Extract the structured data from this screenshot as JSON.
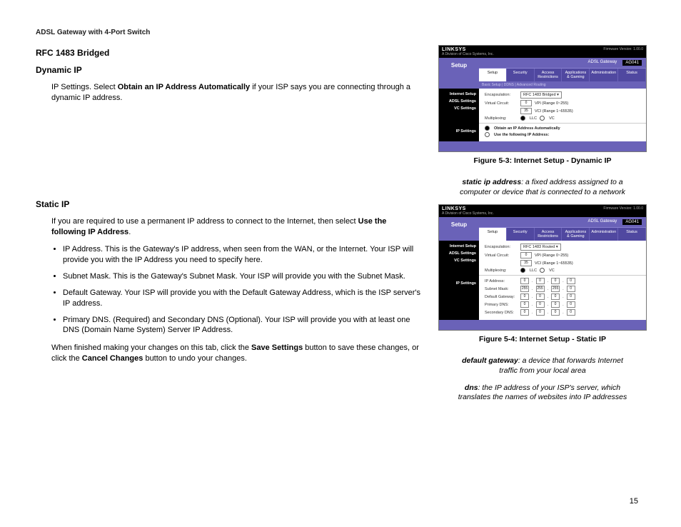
{
  "header": "ADSL Gateway with 4-Port Switch",
  "left": {
    "h1": "RFC 1483 Bridged",
    "h2": "Dynamic IP",
    "p1_pre": "IP Settings. Select ",
    "p1_bold": "Obtain an IP Address Automatically",
    "p1_post": " if your ISP says you are connecting through a dynamic IP address.",
    "h3": "Static IP",
    "p2_pre": "If you are required to use a permanent IP address to connect to the Internet, then select ",
    "p2_bold": "Use the following IP Address",
    "p2_post": ".",
    "li1": "IP Address. This is the Gateway's IP address, when seen from the WAN, or the Internet. Your ISP will provide you with the IP Address you need to specify here.",
    "li2": "Subnet Mask. This is the Gateway's Subnet Mask. Your ISP will provide you with the Subnet Mask.",
    "li3": "Default Gateway. Your ISP will provide you with the Default Gateway Address, which is the ISP server's IP address.",
    "li4": "Primary DNS. (Required) and Secondary DNS (Optional). Your ISP will provide you with at least one DNS (Domain Name System) Server IP Address.",
    "p3_pre": "When finished making your changes on this tab, click the ",
    "p3_b1": "Save Settings",
    "p3_mid": " button to save these changes, or click the ",
    "p3_b2": "Cancel Changes",
    "p3_post": " button to undo your changes."
  },
  "right": {
    "fig1": {
      "brand": "LINKSYS",
      "subbrand": "A Division of Cisco Systems, Inc.",
      "fw": "Firmware Version: 1.00.0",
      "title": "ADSL Gateway",
      "model": "AG041",
      "sidelabel": "Setup",
      "tabs": [
        "Setup",
        "Security",
        "Access Restrictions",
        "Applications & Gaming",
        "Administration",
        "Status"
      ],
      "subtabs": "Basic Setup    |    DDNS    |    Advanced Routing",
      "leftnav": [
        "Internet Setup",
        "ADSL Settings",
        "VC Settings",
        "",
        "",
        "IP Settings"
      ],
      "labels": {
        "encap": "Encapsulation:",
        "vc": "Virtual Circuit:",
        "vpi_note": "VPI (Range 0~255)",
        "vci_val": "35",
        "vci_note": "VCI (Range 1~65535)",
        "mux": "Multiplexing:",
        "llc": "LLC",
        "vcx": "VC",
        "opt1": "Obtain an IP Address Automatically",
        "opt2": "Use the following IP Address:"
      },
      "encap_val": "RFC 1483 Bridged",
      "vpi_val": "0",
      "caption": "Figure 5-3: Internet Setup - Dynamic IP"
    },
    "def1": {
      "term": "static ip address",
      "text": ": a fixed address assigned to a computer or device that is connected to a network"
    },
    "fig2": {
      "brand": "LINKSYS",
      "subbrand": "A Division of Cisco Systems, Inc.",
      "fw": "Firmware Version: 1.00.0",
      "title": "ADSL Gateway",
      "model": "AG041",
      "sidelabel": "Setup",
      "tabs": [
        "Setup",
        "Security",
        "Access Restrictions",
        "Applications & Gaming",
        "Administration",
        "Status"
      ],
      "leftnav": [
        "Internet Setup",
        "ADSL Settings",
        "VC Settings",
        "",
        "",
        "IP Settings"
      ],
      "labels": {
        "encap": "Encapsulation:",
        "vc": "Virtual Circuit:",
        "vpi_note": "VPI (Range 0~255)",
        "vci_val": "35",
        "vci_note": "VCI (Range 1~65535)",
        "mux": "Multiplexing:",
        "llc": "LLC",
        "vcx": "VC",
        "ip": "IP Address:",
        "sub": "Subnet Mask:",
        "gw": "Default Gateway:",
        "pdns": "Primary DNS:",
        "sdns": "Secondary DNS:"
      },
      "encap_val": "RFC 1483 Routed",
      "vpi_val": "0",
      "subnet": [
        "255",
        "255",
        "255",
        "0"
      ],
      "zero": "0",
      "caption": "Figure 5-4: Internet Setup - Static IP"
    },
    "def2": {
      "term": "default gateway",
      "text": ": a device that forwards Internet traffic from your local area"
    },
    "def3": {
      "term": "dns",
      "text": ": the IP address of your ISP's server, which translates the names of websites into IP addresses"
    }
  },
  "page": "15"
}
